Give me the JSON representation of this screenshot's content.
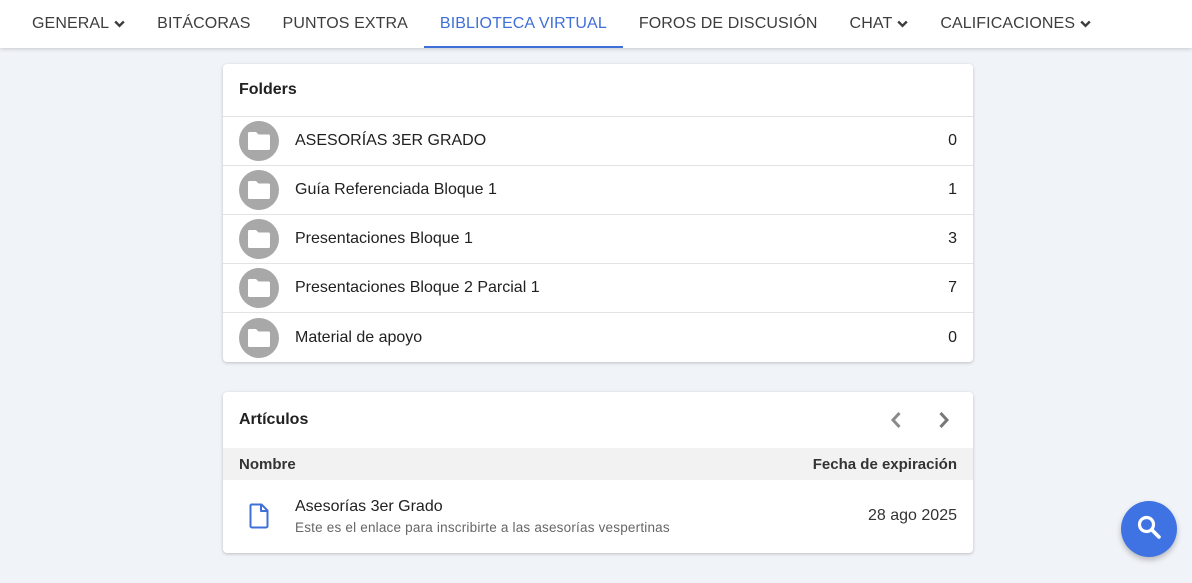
{
  "nav": {
    "items": [
      {
        "label": "GENERAL",
        "dropdown": true,
        "active": false
      },
      {
        "label": "BITÁCORAS",
        "dropdown": false,
        "active": false
      },
      {
        "label": "PUNTOS EXTRA",
        "dropdown": false,
        "active": false
      },
      {
        "label": "BIBLIOTECA VIRTUAL",
        "dropdown": false,
        "active": true
      },
      {
        "label": "FOROS DE DISCUSIÓN",
        "dropdown": false,
        "active": false
      },
      {
        "label": "CHAT",
        "dropdown": true,
        "active": false
      },
      {
        "label": "CALIFICACIONES",
        "dropdown": true,
        "active": false
      }
    ]
  },
  "folders": {
    "title": "Folders",
    "items": [
      {
        "name": "ASESORÍAS 3ER GRADO",
        "count": "0"
      },
      {
        "name": "Guía Referenciada Bloque 1",
        "count": "1"
      },
      {
        "name": "Presentaciones Bloque 1",
        "count": "3"
      },
      {
        "name": "Presentaciones Bloque 2 Parcial 1",
        "count": "7"
      },
      {
        "name": "Material de apoyo",
        "count": "0"
      }
    ]
  },
  "articles": {
    "title": "Artículos",
    "columns": {
      "name": "Nombre",
      "expiration": "Fecha de expiración"
    },
    "rows": [
      {
        "title": "Asesorías 3er Grado",
        "description": "Este es el enlace para inscribirte a las asesorías vespertinas",
        "expiration": "28 ago 2025"
      }
    ]
  },
  "icons": {
    "folder": "folder-icon",
    "document": "document-icon",
    "search": "search-icon",
    "prev": "chevron-left-icon",
    "next": "chevron-right-icon",
    "caret": "chevron-down-icon"
  },
  "colors": {
    "accent": "#3f6fd8",
    "fab": "#3f73e3",
    "folder_avatar": "#a8a8a8",
    "background": "#f0f3f8"
  }
}
